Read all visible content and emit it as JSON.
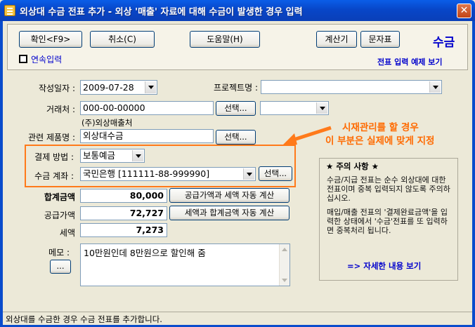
{
  "window": {
    "title": "외상대 수금 전표 추가 - 외상 '매출' 자료에 대해 수금이 발생한 경우 입력",
    "close_glyph": "✕"
  },
  "toolbar": {
    "confirm_label": "확인<F9>",
    "cancel_label": "취소(C)",
    "help_label": "도움말(H)",
    "calculator_label": "계산기",
    "sms_label": "문자표",
    "mode_title": "수금",
    "continuous_input_label": "연속입력",
    "continuous_input_checked": false,
    "example_link": "전표 입력 예제 보기"
  },
  "form": {
    "date_label": "작성일자 :",
    "date_value": "2009-07-28",
    "project_label": "프로젝트명 :",
    "project_value": "",
    "client_label": "거래처 :",
    "client_code": "000-00-00000",
    "client_select_label": "선택...",
    "client_extra_value": "",
    "client_name": "(주)외상매출처",
    "product_label": "관련 제품명 :",
    "product_value": "외상대수금",
    "product_select_label": "선택...",
    "payment_method_label": "결제 방법 :",
    "payment_method_value": "보통예금",
    "account_label": "수금 계좌 :",
    "account_value": "국민은행 [111111-88-999990]",
    "account_select_label": "선택...",
    "total_label": "합계금액",
    "total_value": "80,000",
    "total_auto_calc_label": "공급가액과 세액 자동 계산",
    "supply_label": "공급가액",
    "supply_value": "72,727",
    "supply_auto_calc_label": "세액과 합계금액 자동 계산",
    "tax_label": "세액",
    "tax_value": "7,273",
    "memo_label": "메모 :",
    "memo_value": "10만원인데 8만원으로 할인해 줌",
    "memo_more_label": "..."
  },
  "annotation": {
    "line1": "시재관리를 할 경우",
    "line2": "이 부분은 실제에 맞게 지정"
  },
  "notice": {
    "title": "★ 주의 사항 ★",
    "paragraph1": "수금/지급 전표는 순수 외상대에 대한 전표이며 중복 입력되지 않도록 주의하십시오.",
    "paragraph2": "매입/매출 전표의 '결제완료금액'을 입력한 상태에서 '수금'전표를 또 입력하면 중복처리 됩니다.",
    "detail_link": "=> 자세한 내용 보기"
  },
  "status_bar": {
    "text": "외상대를 수금한 경우 수금 전표를 추가합니다."
  },
  "colors": {
    "title_bar": "#0846c8",
    "accent_blue": "#0000cc",
    "annotation_orange": "#ff6a00"
  }
}
